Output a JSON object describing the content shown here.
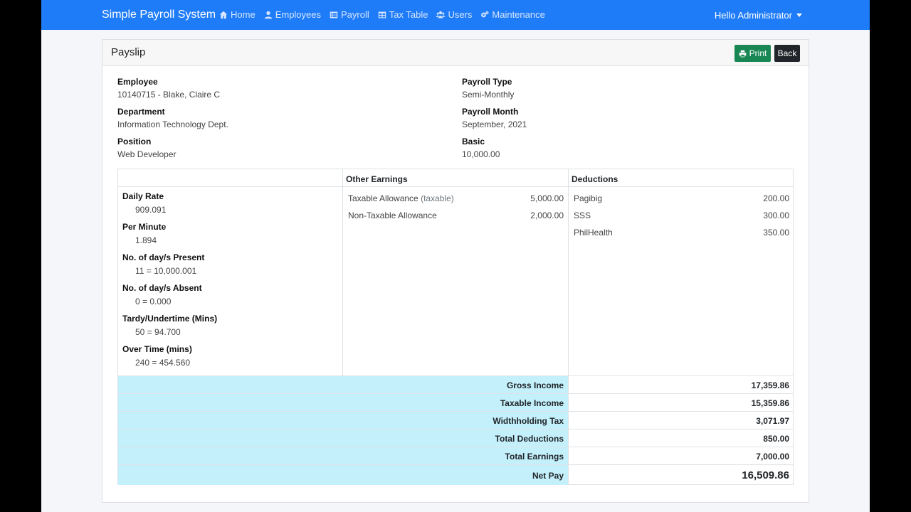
{
  "nav": {
    "brand": "Simple Payroll System",
    "links": [
      {
        "label": "Home",
        "icon": "home-icon"
      },
      {
        "label": "Employees",
        "icon": "user-icon"
      },
      {
        "label": "Payroll",
        "icon": "list-icon"
      },
      {
        "label": "Tax Table",
        "icon": "table-icon"
      },
      {
        "label": "Users",
        "icon": "users-icon"
      },
      {
        "label": "Maintenance",
        "icon": "cogs-icon"
      }
    ],
    "user": "Hello Administrator"
  },
  "card": {
    "title": "Payslip",
    "print_label": "Print",
    "back_label": "Back"
  },
  "info": {
    "employee_label": "Employee",
    "employee": "10140715 - Blake, Claire C",
    "department_label": "Department",
    "department": "Information Technology Dept.",
    "position_label": "Position",
    "position": "Web Developer",
    "payroll_type_label": "Payroll Type",
    "payroll_type": "Semi-Monthly",
    "payroll_month_label": "Payroll Month",
    "payroll_month": "September, 2021",
    "basic_label": "Basic",
    "basic": "10,000.00"
  },
  "sheet": {
    "other_earnings_header": "Other Earnings",
    "deductions_header": "Deductions",
    "attributes": [
      {
        "label": "Daily Rate",
        "value": "909.091"
      },
      {
        "label": "Per Minute",
        "value": "1.894"
      },
      {
        "label": "No. of day/s Present",
        "value": "11 = 10,000.001"
      },
      {
        "label": "No. of day/s Absent",
        "value": "0 = 0.000"
      },
      {
        "label": "Tardy/Undertime (Mins)",
        "value": "50 = 94.700"
      },
      {
        "label": "Over Time (mins)",
        "value": "240 = 454.560"
      }
    ],
    "earnings": [
      {
        "name": "Taxable Allowance",
        "tag": "(taxable)",
        "amount": "5,000.00"
      },
      {
        "name": "Non-Taxable Allowance",
        "tag": "",
        "amount": "2,000.00"
      }
    ],
    "deductions": [
      {
        "name": "Pagibig",
        "amount": "200.00"
      },
      {
        "name": "SSS",
        "amount": "300.00"
      },
      {
        "name": "PhilHealth",
        "amount": "350.00"
      }
    ]
  },
  "totals": [
    {
      "label": "Gross Income",
      "value": "17,359.86"
    },
    {
      "label": "Taxable Income",
      "value": "15,359.86"
    },
    {
      "label": "Widthholding Tax",
      "value": "3,071.97"
    },
    {
      "label": "Total Deductions",
      "value": "850.00"
    },
    {
      "label": "Total Earnings",
      "value": "7,000.00"
    },
    {
      "label": "Net Pay",
      "value": "16,509.86"
    }
  ]
}
